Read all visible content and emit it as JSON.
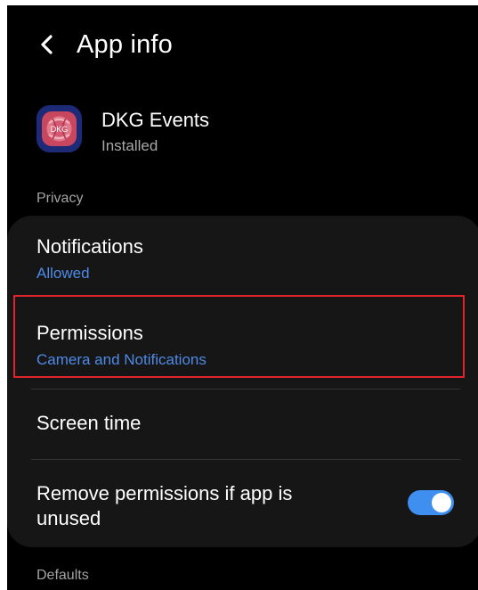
{
  "header": {
    "title": "App info",
    "back_icon": "chevron-left-icon"
  },
  "app": {
    "name": "DKG Events",
    "status": "Installed",
    "icon": "app-icon",
    "icon_label": "DKG",
    "icon_color": "#1d2a78"
  },
  "sections": {
    "privacy": "Privacy",
    "defaults": "Defaults"
  },
  "settings": {
    "notifications": {
      "title": "Notifications",
      "value": "Allowed"
    },
    "permissions": {
      "title": "Permissions",
      "value": "Camera and Notifications",
      "highlighted": true
    },
    "screen_time": {
      "title": "Screen time"
    },
    "remove_permissions": {
      "title_line1": "Remove permissions if app is",
      "title_line2": "unused",
      "enabled": true
    }
  },
  "colors": {
    "background": "#000000",
    "card": "#161616",
    "accent": "#4e8ae6",
    "toggle_on": "#3e8ff0",
    "highlight": "#e0242c"
  }
}
